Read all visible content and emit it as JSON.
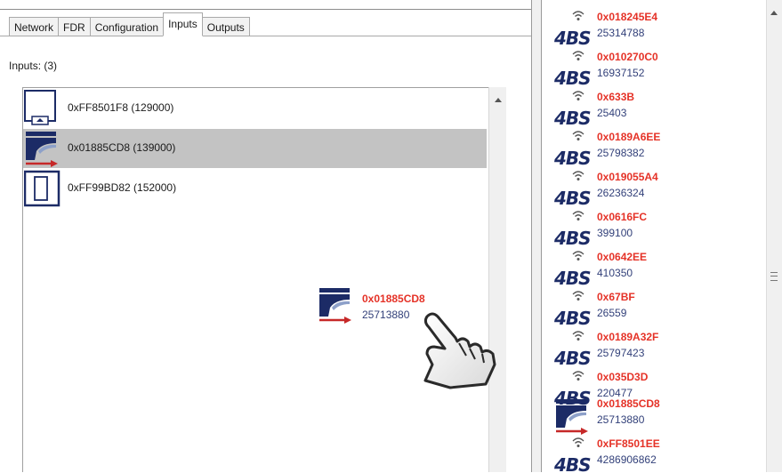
{
  "tabs": [
    "Network",
    "FDR",
    "Configuration",
    "Inputs",
    "Outputs"
  ],
  "active_tab": "Inputs",
  "inputs_label": "Inputs: (3)",
  "inputs": [
    {
      "label": "0xFF8501F8 (129000)",
      "icon": "keypad-device-icon",
      "selected": false
    },
    {
      "label": "0x01885CD8 (139000)",
      "icon": "blind-actuator-icon",
      "selected": true
    },
    {
      "label": "0xFF99BD82 (152000)",
      "icon": "single-switch-icon",
      "selected": false
    }
  ],
  "drag_item": {
    "hex": "0x01885CD8",
    "number": "25713880",
    "icon": "blind-actuator-icon"
  },
  "cursor_icon": "hand-pointer-icon",
  "device_list": [
    {
      "hex": "0x018245E4",
      "number": "25314788",
      "icon": "4bs-wireless-icon",
      "logo": "4BS"
    },
    {
      "hex": "0x010270C0",
      "number": "16937152",
      "icon": "4bs-wireless-icon",
      "logo": "4BS"
    },
    {
      "hex": "0x633B",
      "number": "25403",
      "icon": "4bs-wireless-icon",
      "logo": "4BS"
    },
    {
      "hex": "0x0189A6EE",
      "number": "25798382",
      "icon": "4bs-wireless-icon",
      "logo": "4BS"
    },
    {
      "hex": "0x019055A4",
      "number": "26236324",
      "icon": "4bs-wireless-icon",
      "logo": "4BS"
    },
    {
      "hex": "0x0616FC",
      "number": "399100",
      "icon": "4bs-wireless-icon",
      "logo": "4BS"
    },
    {
      "hex": "0x0642EE",
      "number": "410350",
      "icon": "4bs-wireless-icon",
      "logo": "4BS"
    },
    {
      "hex": "0x67BF",
      "number": "26559",
      "icon": "4bs-wireless-icon",
      "logo": "4BS"
    },
    {
      "hex": "0x0189A32F",
      "number": "25797423",
      "icon": "4bs-wireless-icon",
      "logo": "4BS"
    },
    {
      "hex": "0x035D3D",
      "number": "220477",
      "icon": "4bs-wireless-icon",
      "logo": "4BS"
    },
    {
      "hex": "0x01885CD8",
      "number": "25713880",
      "icon": "blind-actuator-icon",
      "logo": ""
    },
    {
      "hex": "0xFF8501EE",
      "number": "4286906862",
      "icon": "4bs-wireless-icon",
      "logo": "4BS"
    }
  ],
  "colors": {
    "hex_text": "#e53227",
    "number_text": "#33417a",
    "logo": "#1c2b66",
    "selected_row": "#c3c3c3"
  }
}
